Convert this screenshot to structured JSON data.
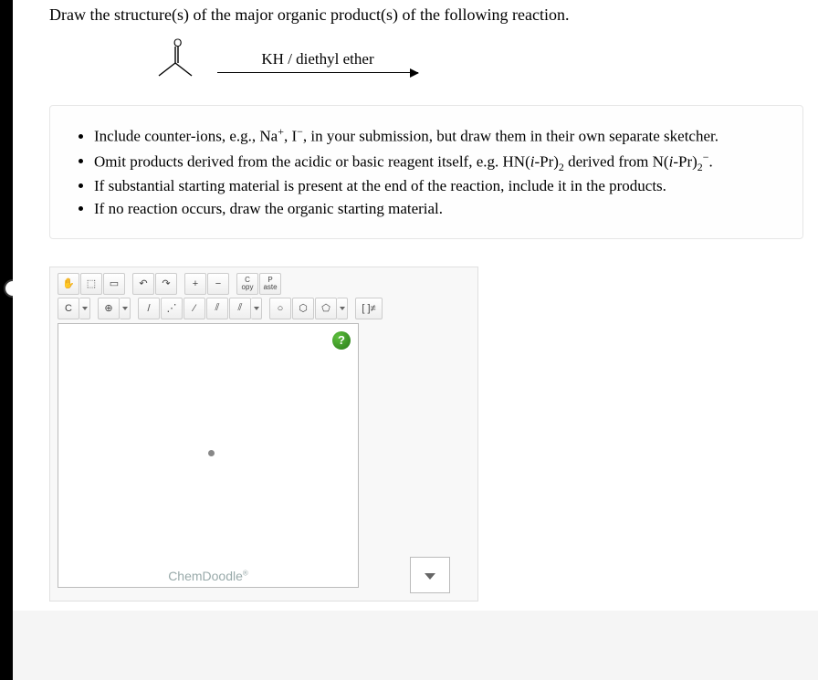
{
  "prompt": "Draw the structure(s) of the major organic product(s) of the following reaction.",
  "reaction": {
    "reagent": "KH / diethyl ether"
  },
  "instructions": [
    "Include counter-ions, e.g., Na⁺, I⁻, in your submission, but draw them in their own separate sketcher.",
    "Omit products derived from the acidic or basic reagent itself, e.g. HN(i-Pr)₂ derived from N(i-Pr)₂⁻.",
    "If substantial starting material is present at the end of the reaction, include it in the products.",
    "If no reaction occurs, draw the organic starting material."
  ],
  "toolbar1": {
    "hand": "✋",
    "lasso": "⬚",
    "eraser": "▭",
    "undo": "↶",
    "redo": "↷",
    "zoom_in": "+",
    "zoom_out": "−",
    "copy_top": "C",
    "copy_bot": "opy",
    "paste_top": "P",
    "paste_bot": "aste"
  },
  "toolbar2": {
    "element": "C",
    "plus": "⊕",
    "bond1": "/",
    "bond_dotted": "⋰",
    "bond2": "⁄",
    "bond3": "⫽",
    "bond4": "⫽",
    "ring1": "○",
    "ring2": "⬡",
    "ring3": "⬠",
    "charges": "[ ]≠"
  },
  "canvas": {
    "help": "?",
    "brand": "ChemDoodle",
    "brand_r": "®"
  }
}
